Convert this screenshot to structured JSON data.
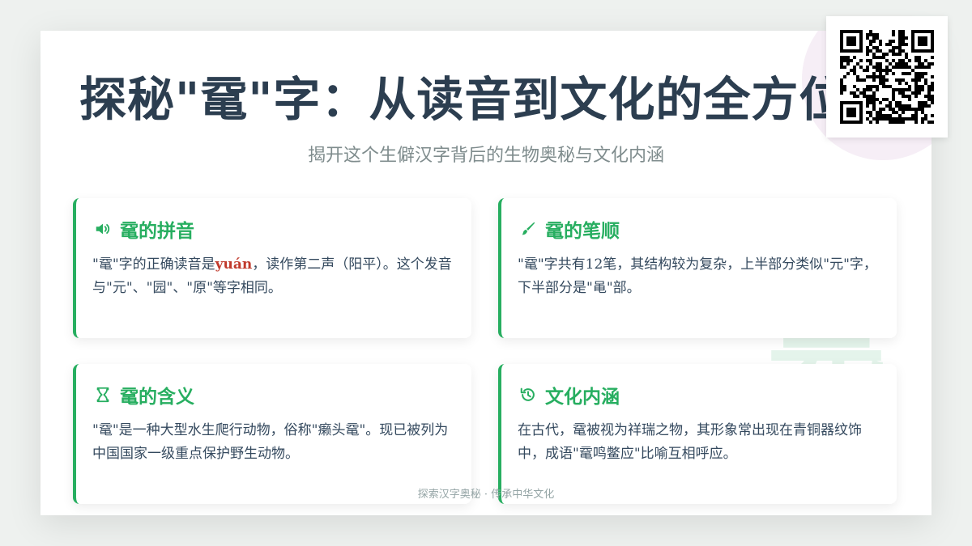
{
  "title": "探秘\"鼋\"字：从读音到文化的全方位解",
  "subtitle": "揭开这个生僻汉字背后的生物奥秘与文化内涵",
  "watermark_char": "鼋",
  "accent_color": "#27ae60",
  "highlight_color": "#c0392b",
  "cards": [
    {
      "icon": "speaker-icon",
      "title": "鼋的拼音",
      "body_before": "\"鼋\"字的正确读音是",
      "body_pinyin": "yuán",
      "body_after": "，读作第二声（阳平）。这个发音与\"元\"、\"园\"、\"原\"等字相同。"
    },
    {
      "icon": "brush-icon",
      "title": "鼋的笔顺",
      "body": "\"鼋\"字共有12笔，其结构较为复杂，上半部分类似\"元\"字，下半部分是\"黾\"部。"
    },
    {
      "icon": "hourglass-icon",
      "title": "鼋的含义",
      "body": "\"鼋\"是一种大型水生爬行动物，俗称\"癞头鼋\"。现已被列为中国国家一级重点保护野生动物。"
    },
    {
      "icon": "history-icon",
      "title": "文化内涵",
      "body": "在古代，鼋被视为祥瑞之物，其形象常出现在青铜器纹饰中，成语\"鼋鸣鳖应\"比喻互相呼应。"
    }
  ],
  "footer": "探索汉字奥秘 · 传承中华文化",
  "qr_code": "qr-code-icon"
}
